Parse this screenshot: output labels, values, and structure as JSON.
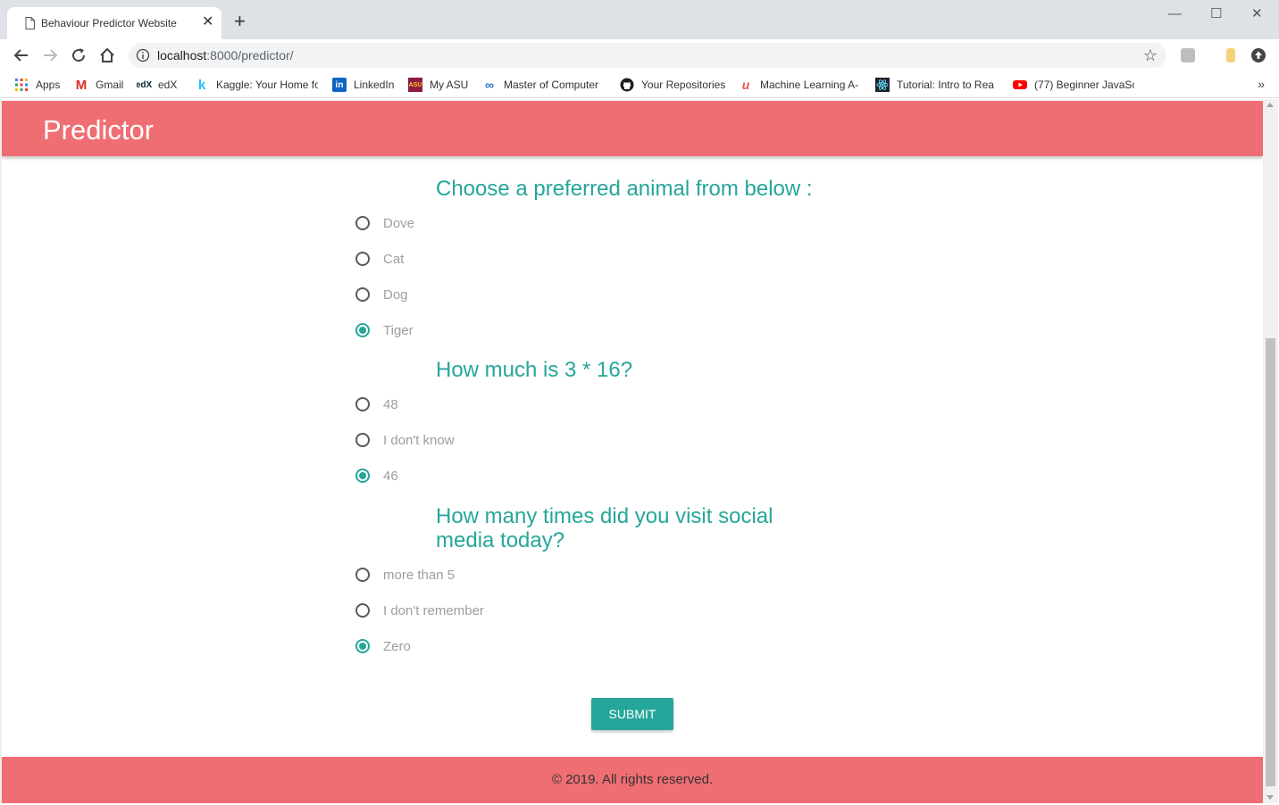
{
  "browser": {
    "tab_title": "Behaviour Predictor Website",
    "tab_close": "✕",
    "new_tab": "+",
    "window_controls": {
      "minimize": "—",
      "maximize": "☐",
      "close": "✕"
    },
    "url_host": "localhost",
    "url_path": ":8000/predictor/",
    "bookmark_star": "☆",
    "bookmarks": [
      {
        "label": "Apps",
        "icon": "apps-grid-icon"
      },
      {
        "label": "Gmail",
        "icon": "gmail-icon"
      },
      {
        "label": "edX",
        "icon": "edx-icon"
      },
      {
        "label": "Kaggle: Your Home fo",
        "icon": "kaggle-icon"
      },
      {
        "label": "LinkedIn",
        "icon": "linkedin-icon"
      },
      {
        "label": "My ASU",
        "icon": "asu-icon"
      },
      {
        "label": "Master of Computer",
        "icon": "coursera-icon"
      },
      {
        "label": "Your Repositories",
        "icon": "github-icon"
      },
      {
        "label": "Machine Learning A-",
        "icon": "udemy-icon"
      },
      {
        "label": "Tutorial: Intro to Rea",
        "icon": "react-icon"
      },
      {
        "label": "(77) Beginner JavaScr",
        "icon": "youtube-icon"
      }
    ],
    "bookmarks_more": "»"
  },
  "site": {
    "title": "Predictor",
    "footer": "© 2019. All rights reserved."
  },
  "questions": [
    {
      "text": "Choose a preferred animal from below :",
      "options": [
        {
          "label": "Dove",
          "checked": false
        },
        {
          "label": "Cat",
          "checked": false
        },
        {
          "label": "Dog",
          "checked": false
        },
        {
          "label": "Tiger",
          "checked": true
        }
      ]
    },
    {
      "text": "How much is 3 * 16?",
      "options": [
        {
          "label": "48",
          "checked": false
        },
        {
          "label": "I don't know",
          "checked": false
        },
        {
          "label": "46",
          "checked": true
        }
      ]
    },
    {
      "text": "How many times did you visit social media today?",
      "options": [
        {
          "label": "more than 5",
          "checked": false
        },
        {
          "label": "I don't remember",
          "checked": false
        },
        {
          "label": "Zero",
          "checked": true
        }
      ]
    }
  ],
  "submit_label": "Submit",
  "colors": {
    "brand": "#ef6e73",
    "accent": "#26a69a"
  }
}
